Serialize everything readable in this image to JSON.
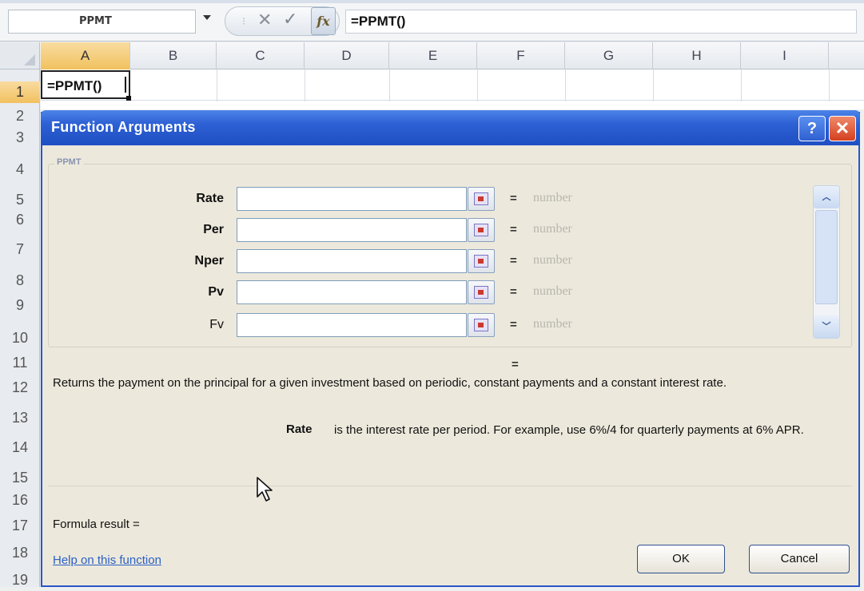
{
  "formula_bar": {
    "name_box": "PPMT",
    "formula": "=PPMT()",
    "fx_label": "fx"
  },
  "grid": {
    "columns": [
      "A",
      "B",
      "C",
      "D",
      "E",
      "F",
      "G",
      "H",
      "I"
    ],
    "rows": [
      "1",
      "2",
      "3",
      "4",
      "5",
      "6",
      "7",
      "8",
      "9",
      "10",
      "11",
      "12",
      "13",
      "14",
      "15",
      "16",
      "17",
      "18",
      "19"
    ],
    "active_cell_value": "=PPMT()"
  },
  "dialog": {
    "title": "Function Arguments",
    "help_glyph": "?",
    "close_glyph": "✕",
    "function_name": "PPMT",
    "arguments": [
      {
        "label": "Rate",
        "value": "",
        "hint": "number"
      },
      {
        "label": "Per",
        "value": "",
        "hint": "number"
      },
      {
        "label": "Nper",
        "value": "",
        "hint": "number"
      },
      {
        "label": "Pv",
        "value": "",
        "hint": "number"
      },
      {
        "label": "Fv",
        "value": "",
        "hint": "number"
      }
    ],
    "equals": "=",
    "result_equals": "=",
    "description": "Returns the payment on the principal for a given investment based on periodic, constant payments and a constant interest rate.",
    "arg_desc_name": "Rate",
    "arg_desc": "is the interest rate per period. For example, use 6%/4 for quarterly payments at 6% APR.",
    "formula_result": "Formula result =",
    "help_link": "Help on this function",
    "ok": "OK",
    "cancel": "Cancel"
  }
}
